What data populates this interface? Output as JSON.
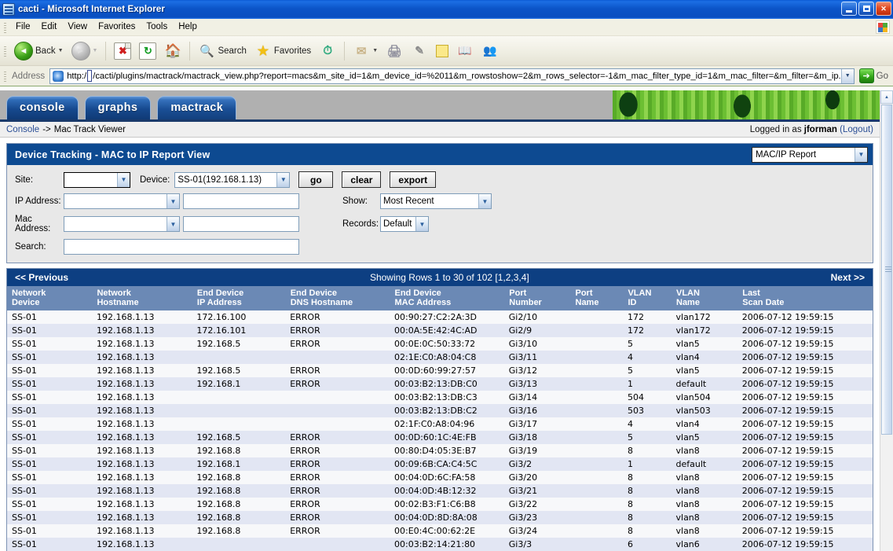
{
  "window": {
    "title": "cacti - Microsoft Internet Explorer",
    "icon": "page-icon",
    "minimize": "_",
    "maximize": "□",
    "close": "✕"
  },
  "menu": {
    "items": [
      "File",
      "Edit",
      "View",
      "Favorites",
      "Tools",
      "Help"
    ]
  },
  "toolbar": {
    "back_label": "Back",
    "forward_label": "",
    "search_label": "Search",
    "favorites_label": "Favorites",
    "icons": [
      "back-icon",
      "forward-icon",
      "stop-icon",
      "refresh-icon",
      "home-icon",
      "search-icon",
      "favorites-icon",
      "history-icon",
      "mail-icon",
      "print-icon",
      "edit-icon",
      "notes-icon",
      "research-icon",
      "messenger-icon"
    ]
  },
  "address": {
    "label": "Address",
    "url_prefix": "http:/",
    "url_suffix": "/cacti/plugins/mactrack/mactrack_view.php?report=macs&m_site_id=1&m_device_id=%2011&m_rowstoshow=2&m_rows_selector=-1&m_mac_filter_type_id=1&m_mac_filter=&m_filter=&m_ip.",
    "go_label": "Go"
  },
  "cacti": {
    "tabs": [
      {
        "label": "console",
        "active": false
      },
      {
        "label": "graphs",
        "active": false
      },
      {
        "label": "mactrack",
        "active": true
      }
    ],
    "breadcrumb_link": "Console",
    "breadcrumb_sep": "->",
    "breadcrumb_current": "Mac Track Viewer",
    "logged_in_prefix": "Logged in as",
    "logged_in_user": "jforman",
    "logout_label": "(Logout)"
  },
  "filter": {
    "title": "Device Tracking - MAC to IP Report View",
    "report_type": "MAC/IP Report",
    "site_label": "Site:",
    "site_value": "",
    "device_label": "Device:",
    "device_value": "SS-01(192.168.1.13)",
    "go_button": "go",
    "clear_button": "clear",
    "export_button": "export",
    "ip_label": "IP Address:",
    "ip_select_value": "",
    "ip_text_value": "",
    "mac_label": "Mac Address:",
    "mac_select_value": "",
    "mac_text_value": "",
    "search_label": "Search:",
    "search_value": "",
    "show_label": "Show:",
    "show_value": "Most Recent",
    "records_label": "Records:",
    "records_value": "Default"
  },
  "pagination": {
    "previous": "<< Previous",
    "showing": "Showing Rows 1 to 30 of 102 [1,2,3,4]",
    "next": "Next >>"
  },
  "table": {
    "columns": [
      {
        "l1": "Network",
        "l2": "Device"
      },
      {
        "l1": "Network",
        "l2": "Hostname"
      },
      {
        "l1": "End Device",
        "l2": "IP Address"
      },
      {
        "l1": "End Device",
        "l2": "DNS Hostname"
      },
      {
        "l1": "End Device",
        "l2": "MAC Address"
      },
      {
        "l1": "Port",
        "l2": "Number"
      },
      {
        "l1": "Port",
        "l2": "Name"
      },
      {
        "l1": "VLAN",
        "l2": "ID"
      },
      {
        "l1": "VLAN",
        "l2": "Name"
      },
      {
        "l1": "Last",
        "l2": "Scan Date"
      }
    ],
    "rows": [
      [
        "SS-01",
        "192.168.1.13",
        "172.16.100",
        "ERROR",
        "00:90:27:C2:2A:3D",
        "Gi2/10",
        "",
        "172",
        "vlan172",
        "2006-07-12 19:59:15"
      ],
      [
        "SS-01",
        "192.168.1.13",
        "172.16.101",
        "ERROR",
        "00:0A:5E:42:4C:AD",
        "Gi2/9",
        "",
        "172",
        "vlan172",
        "2006-07-12 19:59:15"
      ],
      [
        "SS-01",
        "192.168.1.13",
        "192.168.5",
        "ERROR",
        "00:0E:0C:50:33:72",
        "Gi3/10",
        "",
        "5",
        "vlan5",
        "2006-07-12 19:59:15"
      ],
      [
        "SS-01",
        "192.168.1.13",
        "",
        "",
        "02:1E:C0:A8:04:C8",
        "Gi3/11",
        "",
        "4",
        "vlan4",
        "2006-07-12 19:59:15"
      ],
      [
        "SS-01",
        "192.168.1.13",
        "192.168.5",
        "ERROR",
        "00:0D:60:99:27:57",
        "Gi3/12",
        "",
        "5",
        "vlan5",
        "2006-07-12 19:59:15"
      ],
      [
        "SS-01",
        "192.168.1.13",
        "192.168.1",
        "ERROR",
        "00:03:B2:13:DB:C0",
        "Gi3/13",
        "",
        "1",
        "default",
        "2006-07-12 19:59:15"
      ],
      [
        "SS-01",
        "192.168.1.13",
        "",
        "",
        "00:03:B2:13:DB:C3",
        "Gi3/14",
        "",
        "504",
        "vlan504",
        "2006-07-12 19:59:15"
      ],
      [
        "SS-01",
        "192.168.1.13",
        "",
        "",
        "00:03:B2:13:DB:C2",
        "Gi3/16",
        "",
        "503",
        "vlan503",
        "2006-07-12 19:59:15"
      ],
      [
        "SS-01",
        "192.168.1.13",
        "",
        "",
        "02:1F:C0:A8:04:96",
        "Gi3/17",
        "",
        "4",
        "vlan4",
        "2006-07-12 19:59:15"
      ],
      [
        "SS-01",
        "192.168.1.13",
        "192.168.5",
        "ERROR",
        "00:0D:60:1C:4E:FB",
        "Gi3/18",
        "",
        "5",
        "vlan5",
        "2006-07-12 19:59:15"
      ],
      [
        "SS-01",
        "192.168.1.13",
        "192.168.8",
        "ERROR",
        "00:80:D4:05:3E:B7",
        "Gi3/19",
        "",
        "8",
        "vlan8",
        "2006-07-12 19:59:15"
      ],
      [
        "SS-01",
        "192.168.1.13",
        "192.168.1",
        "ERROR",
        "00:09:6B:CA:C4:5C",
        "Gi3/2",
        "",
        "1",
        "default",
        "2006-07-12 19:59:15"
      ],
      [
        "SS-01",
        "192.168.1.13",
        "192.168.8",
        "ERROR",
        "00:04:0D:6C:FA:58",
        "Gi3/20",
        "",
        "8",
        "vlan8",
        "2006-07-12 19:59:15"
      ],
      [
        "SS-01",
        "192.168.1.13",
        "192.168.8",
        "ERROR",
        "00:04:0D:4B:12:32",
        "Gi3/21",
        "",
        "8",
        "vlan8",
        "2006-07-12 19:59:15"
      ],
      [
        "SS-01",
        "192.168.1.13",
        "192.168.8",
        "ERROR",
        "00:02:B3:F1:C6:B8",
        "Gi3/22",
        "",
        "8",
        "vlan8",
        "2006-07-12 19:59:15"
      ],
      [
        "SS-01",
        "192.168.1.13",
        "192.168.8",
        "ERROR",
        "00:04:0D:8D:8A:08",
        "Gi3/23",
        "",
        "8",
        "vlan8",
        "2006-07-12 19:59:15"
      ],
      [
        "SS-01",
        "192.168.1.13",
        "192.168.8",
        "ERROR",
        "00:E0:4C:00:62:2E",
        "Gi3/24",
        "",
        "8",
        "vlan8",
        "2006-07-12 19:59:15"
      ],
      [
        "SS-01",
        "192.168.1.13",
        "",
        "",
        "00:03:B2:14:21:80",
        "Gi3/3",
        "",
        "6",
        "vlan6",
        "2006-07-12 19:59:15"
      ]
    ]
  }
}
